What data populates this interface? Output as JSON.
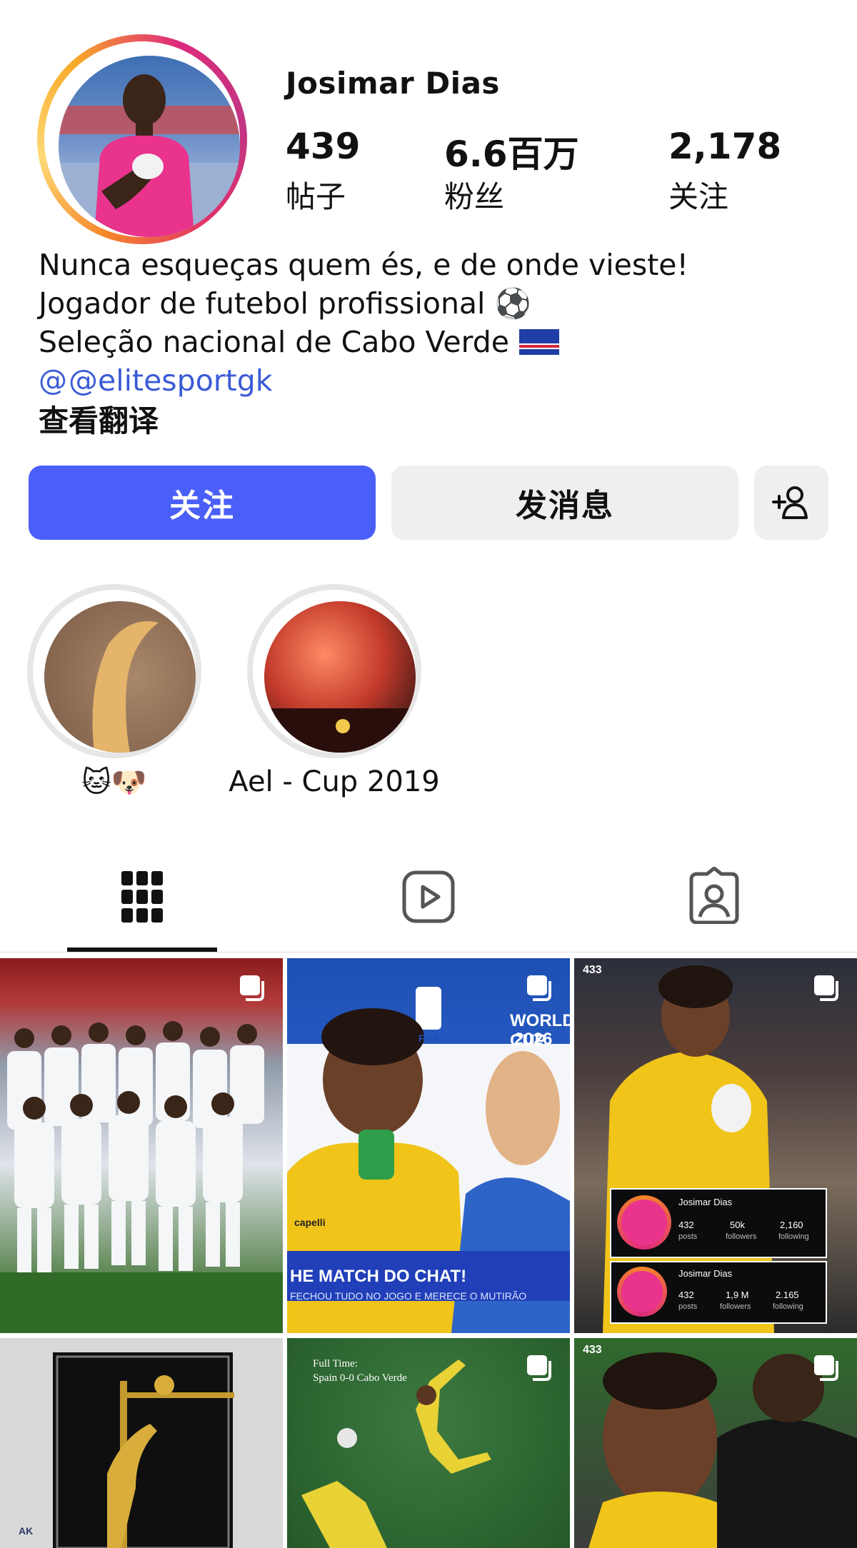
{
  "profile": {
    "name": "Josimar Dias",
    "stats": [
      {
        "value": "439",
        "label": "帖子"
      },
      {
        "value": "6.6百万",
        "label": "粉丝"
      },
      {
        "value": "2,178",
        "label": "关注"
      }
    ]
  },
  "bio": {
    "lines": [
      "Nunca esqueças quem és, e de onde vieste!",
      "Jogador de futebol profissional ⚽",
      "Seleção nacional de Cabo Verde"
    ],
    "link": "@elitesportgk",
    "translate": "查看翻译"
  },
  "actions": {
    "follow": "关注",
    "message": "发消息",
    "add_user_icon": "add-person-icon"
  },
  "highlights": [
    {
      "label": "🐱🐶"
    },
    {
      "label": "Ael - Cup 2019"
    }
  ],
  "tabs": [
    {
      "icon": "grid-icon",
      "selected": true
    },
    {
      "icon": "reels-icon",
      "selected": false
    },
    {
      "icon": "tagged-icon",
      "selected": false
    }
  ],
  "posts": [
    {
      "kind": "team-photo",
      "multi": true
    },
    {
      "kind": "interview",
      "multi": true,
      "overlay_text_1": "WORLD CUP",
      "overlay_text_2": "2026",
      "brand": "FIFA",
      "banner_1": "HE MATCH DO CHAT!",
      "banner_2": "FECHOU TUDO NO JOGO E MERECE O MUTIRÃO",
      "shirt_brand": "capelli"
    },
    {
      "kind": "comparison",
      "multi": true,
      "badge": "433",
      "card_a": {
        "name": "Josimar Dias",
        "posts": "432",
        "followers": "50k",
        "following": "2,160"
      },
      "card_b": {
        "name": "Josimar Dias",
        "posts": "432",
        "followers": "1,9 M",
        "following": "2.165"
      },
      "labels": {
        "posts": "posts",
        "followers": "followers",
        "following": "following"
      }
    },
    {
      "kind": "trophy",
      "multi": false,
      "corner": "AK"
    },
    {
      "kind": "save",
      "multi": true,
      "caption_1": "Full Time:",
      "caption_2": "Spain 0-0 Cabo Verde"
    },
    {
      "kind": "celebration",
      "multi": true,
      "badge": "433"
    }
  ],
  "colors": {
    "follow_button": "#4a5ff7",
    "link": "#3b5bd6",
    "secondary_button": "#efeff1"
  }
}
